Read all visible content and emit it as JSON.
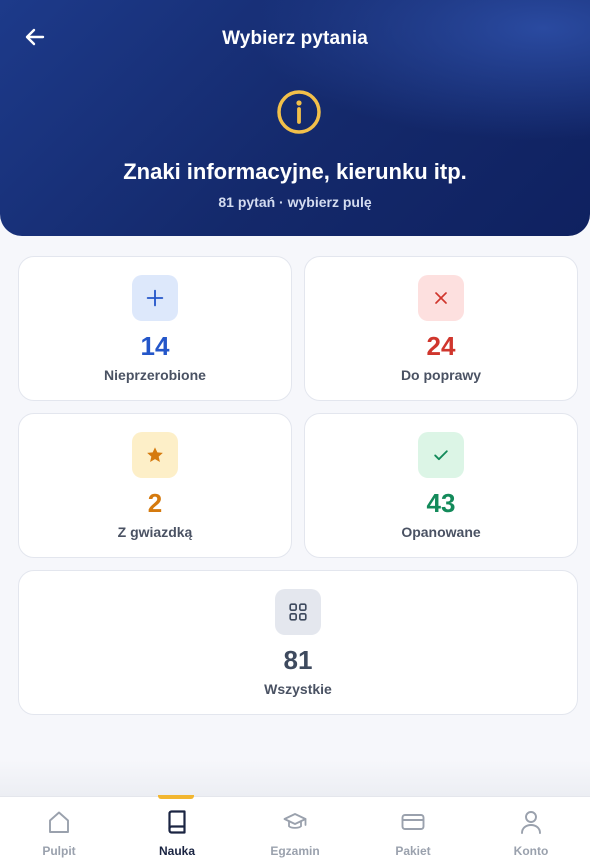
{
  "header": {
    "title": "Wybierz pytania",
    "topic_title": "Znaki informacyjne, kierunku itp.",
    "topic_subtitle": "81 pytań · wybierz pulę",
    "icons": {
      "back": "arrow-left-icon",
      "topic": "info-circle-icon"
    }
  },
  "pools": [
    {
      "id": "unprocessed",
      "count": "14",
      "label": "Nieprzerobione",
      "icon": "plus-icon",
      "color": "#2456c9",
      "bg": "#dde8fb"
    },
    {
      "id": "to-fix",
      "count": "24",
      "label": "Do poprawy",
      "icon": "x-icon",
      "color": "#d0362d",
      "bg": "#fde0df"
    },
    {
      "id": "starred",
      "count": "2",
      "label": "Z gwiazdką",
      "icon": "star-icon",
      "color": "#d57a0e",
      "bg": "#fdefc8"
    },
    {
      "id": "mastered",
      "count": "43",
      "label": "Opanowane",
      "icon": "check-icon",
      "color": "#138a5a",
      "bg": "#dcf5e6"
    },
    {
      "id": "all",
      "count": "81",
      "label": "Wszystkie",
      "icon": "grid-icon",
      "color": "#3e4a5e",
      "bg": "#e4e7ee"
    }
  ],
  "tabs": [
    {
      "label": "Pulpit",
      "icon": "home-icon",
      "active": false
    },
    {
      "label": "Nauka",
      "icon": "book-icon",
      "active": true
    },
    {
      "label": "Egzamin",
      "icon": "graduation-cap-icon",
      "active": false
    },
    {
      "label": "Pakiet",
      "icon": "credit-card-icon",
      "active": false
    },
    {
      "label": "Konto",
      "icon": "user-icon",
      "active": false
    }
  ],
  "colors": {
    "header_bg": "#1d3a8a",
    "accent": "#f2c04a",
    "tab_active": "#1a2442",
    "tab_inactive": "#9aa1ad"
  }
}
